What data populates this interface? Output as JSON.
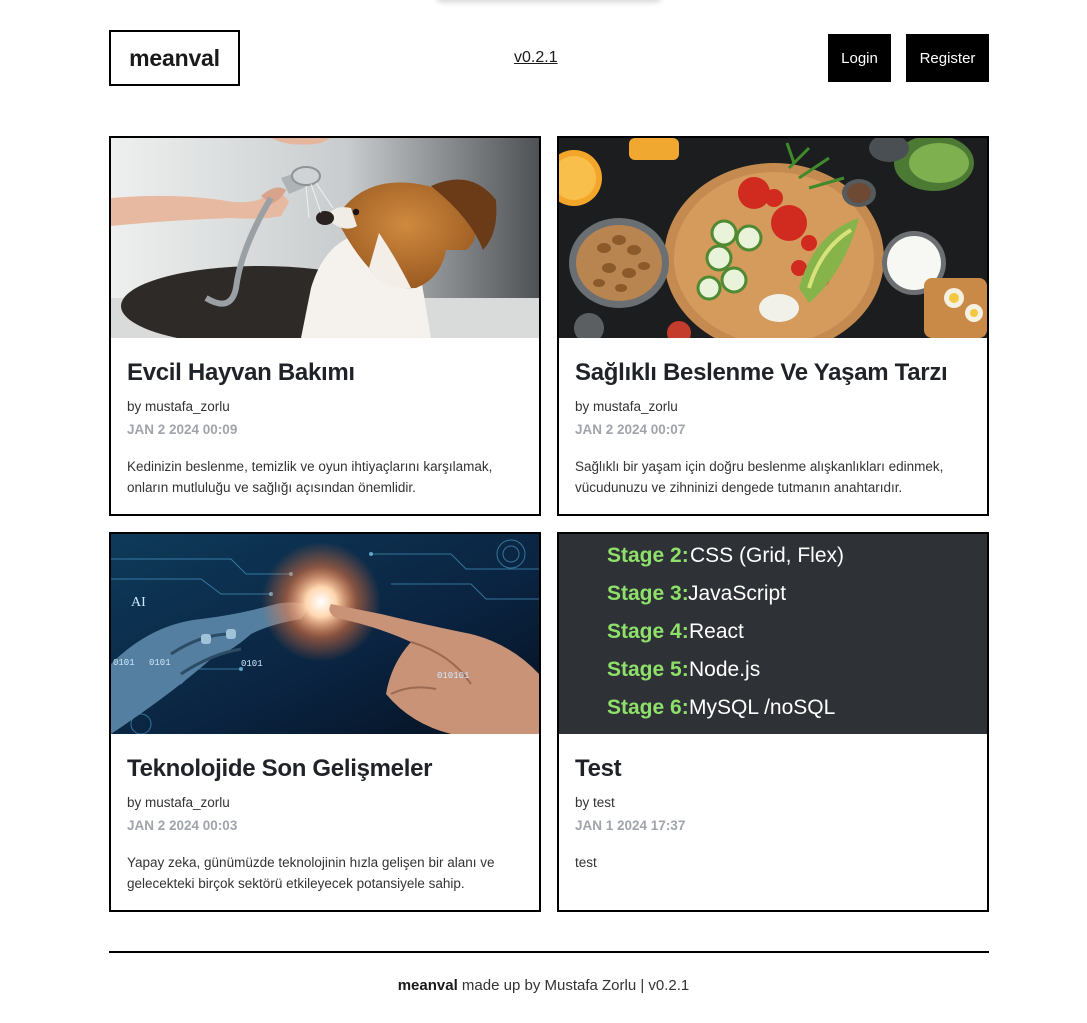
{
  "header": {
    "logo": "meanval",
    "version": "v0.2.1",
    "login_label": "Login",
    "register_label": "Register"
  },
  "posts": [
    {
      "title": "Evcil Hayvan Bakımı",
      "author": "by mustafa_zorlu",
      "date": "JAN 2 2024 00:09",
      "excerpt": "Kedinizin beslenme, temizlik ve oyun ihtiyaçlarını karşılamak, onların mutluluğu ve sağlığı açısından önemlidir.",
      "image": "dog-shower-photo"
    },
    {
      "title": "Sağlıklı Beslenme Ve Yaşam Tarzı",
      "author": "by mustafa_zorlu",
      "date": "JAN 2 2024 00:07",
      "excerpt": "Sağlıklı bir yaşam için doğru beslenme alışkanlıkları edinmek, vücudunuzu ve zihninizi dengede tutmanın anahtarıdır.",
      "image": "healthy-food-photo"
    },
    {
      "title": "Teknolojide Son Gelişmeler",
      "author": "by mustafa_zorlu",
      "date": "JAN 2 2024 00:03",
      "excerpt": "Yapay zeka, günümüzde teknolojinin hızla gelişen bir alanı ve gelecekteki birçok sektörü etkileyecek potansiyele sahip.",
      "image": "ai-robot-hand-photo",
      "image_text": {
        "ai": "AI",
        "bits1": "0101",
        "bits2": "0101",
        "bits3": "010101",
        "bits4": "0101"
      }
    },
    {
      "title": "Test",
      "author": "by test",
      "date": "JAN 1 2024 17:37",
      "excerpt": "test",
      "image": "roadmap-stages-image",
      "stages": [
        {
          "label": "Stage 2:",
          "text": "CSS (Grid, Flex)"
        },
        {
          "label": "Stage 3:",
          "text": "JavaScript"
        },
        {
          "label": "Stage 4:",
          "text": "React"
        },
        {
          "label": "Stage 5:",
          "text": "Node.js"
        },
        {
          "label": "Stage 6:",
          "text": "MySQL /noSQL"
        }
      ]
    }
  ],
  "footer": {
    "brand": "meanval",
    "text": " made up by Mustafa Zorlu | v0.2.1"
  },
  "colors": {
    "stage_green": "#8ee06a",
    "stage_bg": "#2e3135",
    "date_gray": "#a0a4ab"
  }
}
